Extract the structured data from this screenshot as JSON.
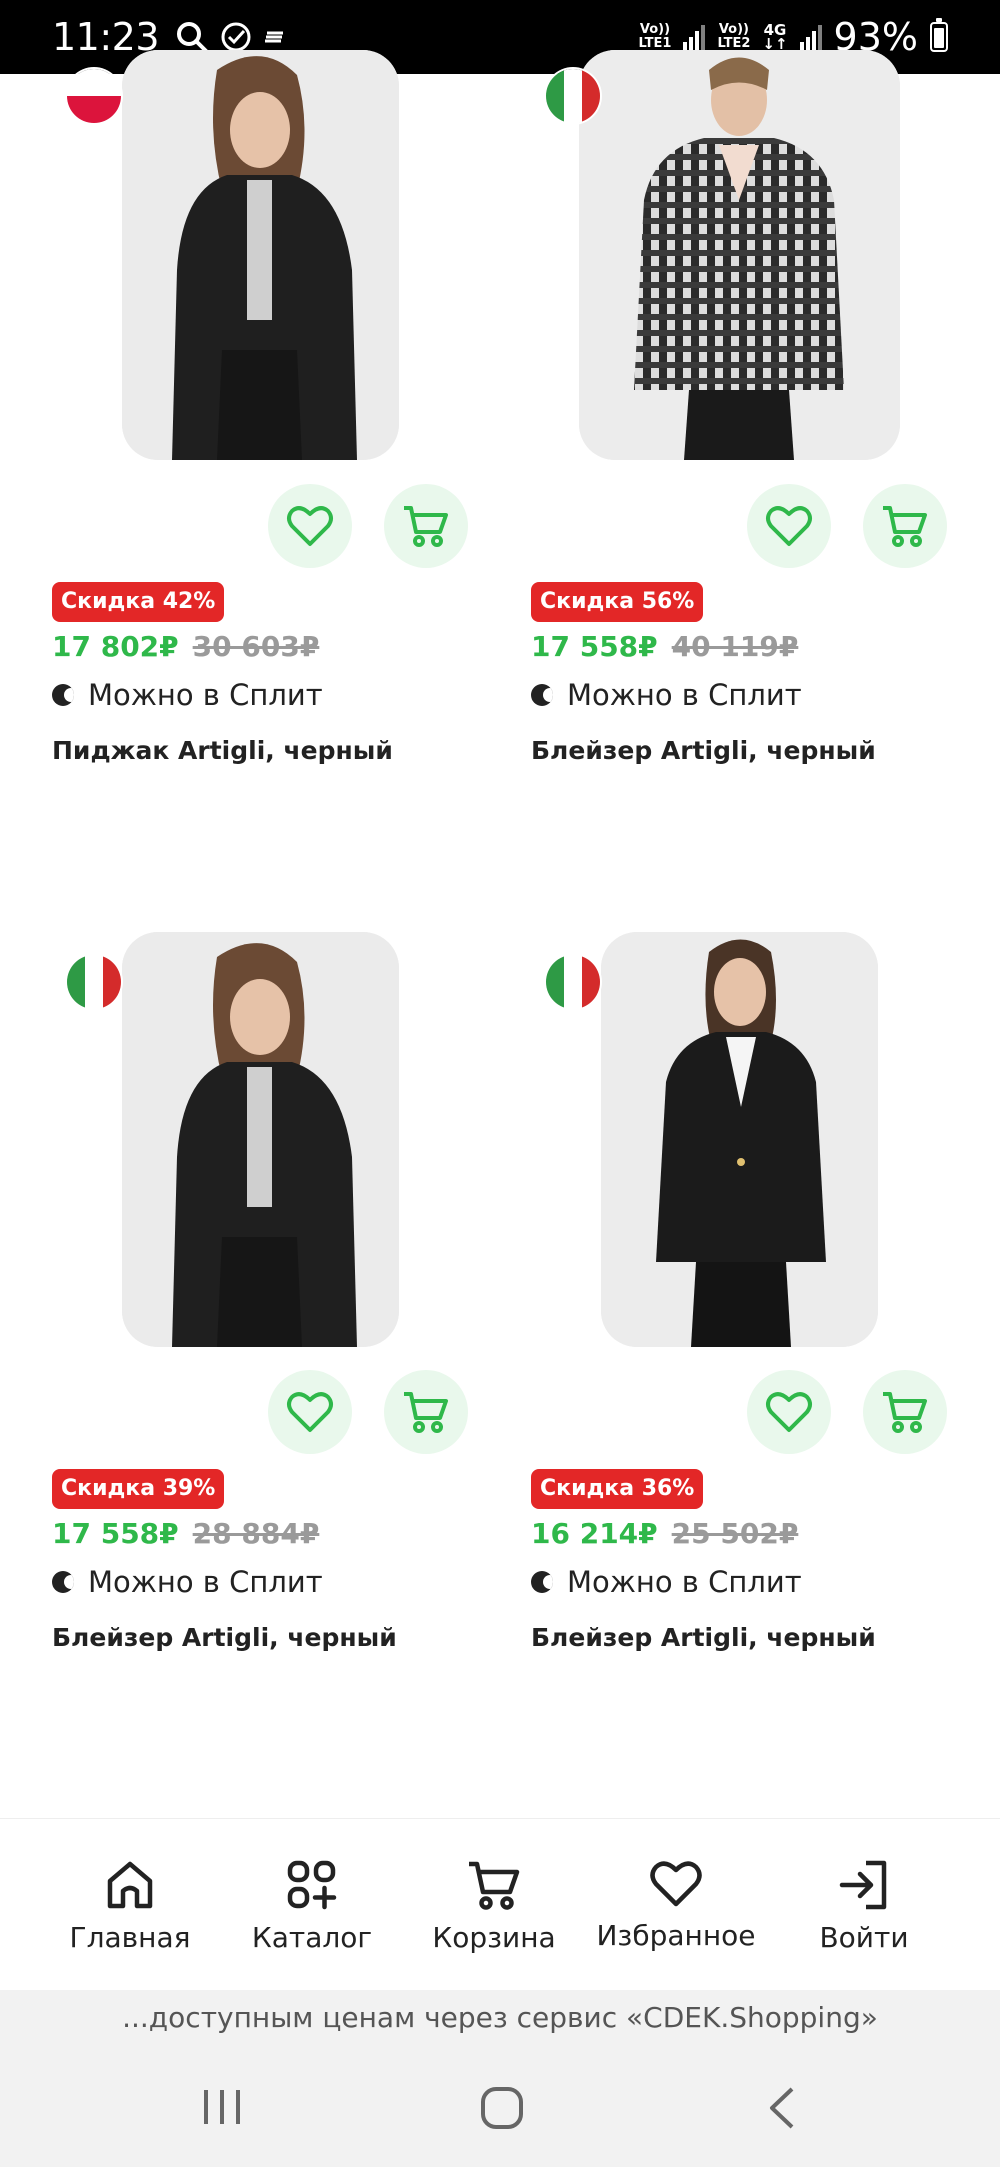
{
  "status_bar": {
    "time": "11:23",
    "net1_top": "Vo))",
    "net1_bottom": "LTE1",
    "net2_top": "Vo))",
    "net2_bottom": "LTE2",
    "net_type": "4G",
    "battery": "93%"
  },
  "products": [
    {
      "flag": "poland",
      "discount": "Скидка 42%",
      "price": "17 802₽",
      "old_price": "30 603₽",
      "split": "Можно в Сплит",
      "title": "Пиджак Artigli, черный"
    },
    {
      "flag": "italy",
      "discount": "Скидка 56%",
      "price": "17 558₽",
      "old_price": "40 119₽",
      "split": "Можно в Сплит",
      "title": "Блейзер Artigli, черный"
    },
    {
      "flag": "italy",
      "discount": "Скидка 39%",
      "price": "17 558₽",
      "old_price": "28 884₽",
      "split": "Можно в Сплит",
      "title": "Блейзер Artigli, черный"
    },
    {
      "flag": "italy",
      "discount": "Скидка 36%",
      "price": "16 214₽",
      "old_price": "25 502₽",
      "split": "Можно в Сплит",
      "title": "Блейзер Artigli, черный"
    }
  ],
  "bottom_nav": {
    "items": [
      {
        "label": "Главная",
        "icon": "home-icon"
      },
      {
        "label": "Каталог",
        "icon": "catalog-icon"
      },
      {
        "label": "Корзина",
        "icon": "cart-icon"
      },
      {
        "label": "Избранное",
        "icon": "heart-icon"
      },
      {
        "label": "Войти",
        "icon": "login-icon"
      }
    ]
  },
  "banner_text": "...доступным ценам через сервис «CDEK.Shopping»",
  "colors": {
    "accent_green": "#2fb84a",
    "discount_red": "#e32727",
    "button_bg": "#e9f8ec"
  }
}
